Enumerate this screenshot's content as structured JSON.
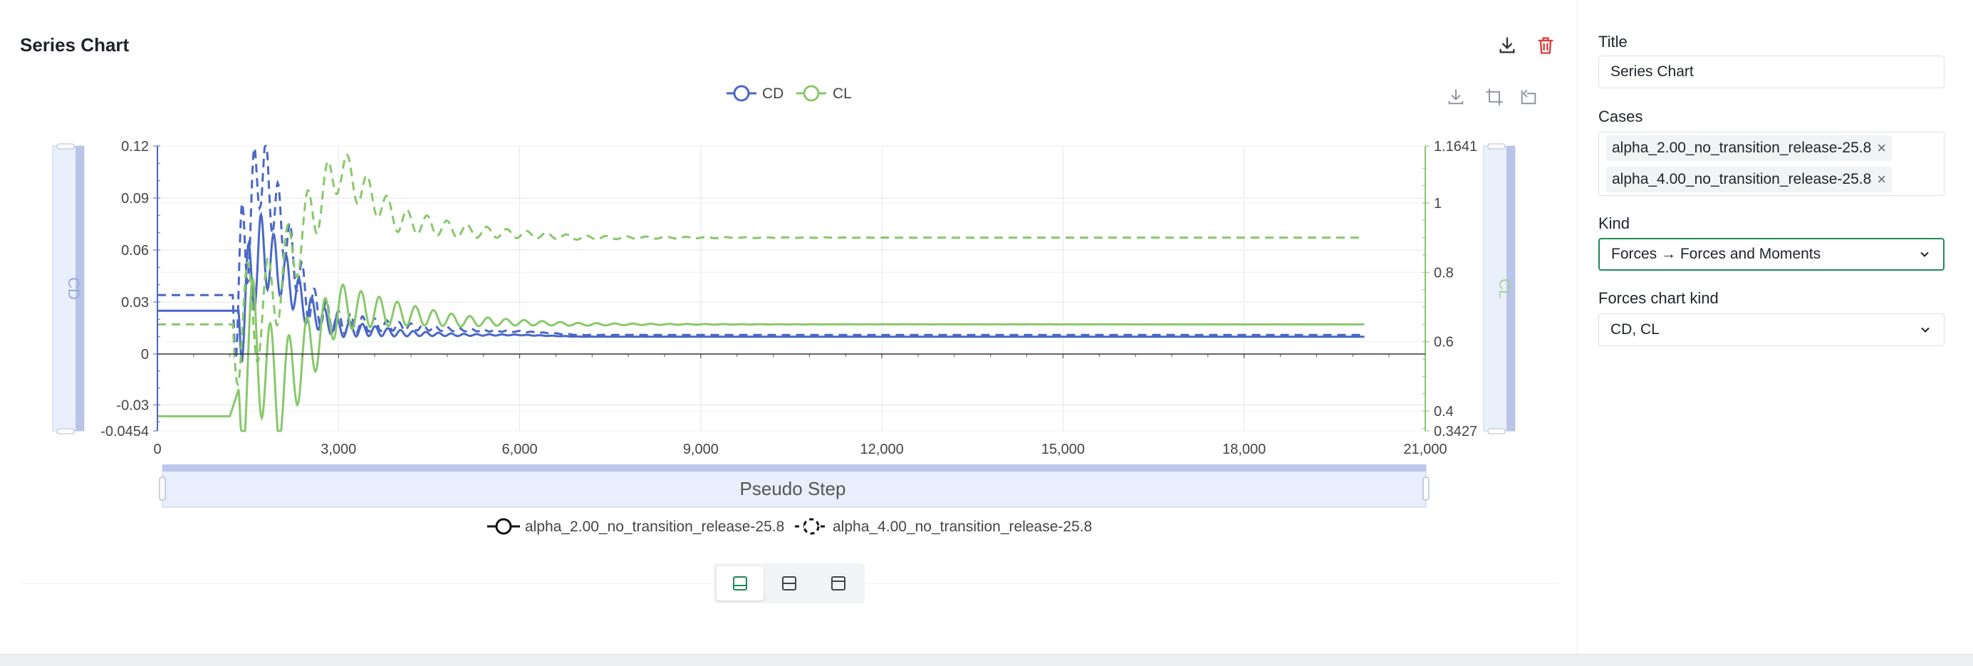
{
  "card": {
    "title": "Series Chart"
  },
  "header_actions": [
    {
      "icon": "download-icon"
    },
    {
      "icon": "trash-icon",
      "color": "#e23b3b"
    }
  ],
  "toolbox": [
    {
      "icon": "save-image-icon"
    },
    {
      "icon": "zoom-select-icon"
    },
    {
      "icon": "zoom-reset-icon"
    }
  ],
  "panel": {
    "title_label": "Title",
    "title_value": "Series Chart",
    "cases_label": "Cases",
    "cases": [
      "alpha_2.00_no_transition_release-25.8",
      "alpha_4.00_no_transition_release-25.8"
    ],
    "kind_label": "Kind",
    "kind_value": "Forces → Forces and Moments",
    "forces_label": "Forces chart kind",
    "forces_value": "CD, CL"
  },
  "layout_buttons": [
    {
      "icon": "layout-bottom-icon",
      "active": true
    },
    {
      "icon": "layout-split-icon",
      "active": false
    },
    {
      "icon": "layout-top-icon",
      "active": false
    }
  ],
  "colors": {
    "cd": "#4a67c6",
    "cl": "#88c86a",
    "accent": "#1e8a57",
    "danger": "#e23b3b"
  },
  "chart_data": {
    "type": "line",
    "title": "",
    "xlabel": "Pseudo Step",
    "ylabel_left": "CD",
    "ylabel_right": "CL",
    "xlim": [
      0,
      21000
    ],
    "ylim_left": [
      -0.0454,
      0.12
    ],
    "ylim_right": [
      0.3427,
      1.1641
    ],
    "x_ticks": [
      "0",
      "3,000",
      "6,000",
      "9,000",
      "12,000",
      "15,000",
      "18,000",
      "21,000"
    ],
    "y_ticks_left": [
      "0.12",
      "0.09",
      "0.06",
      "0.03",
      "0",
      "-0.03",
      "-0.0454"
    ],
    "y_ticks_right": [
      "1.1641",
      "1",
      "0.8",
      "0.6",
      "0.4",
      "0.3427"
    ],
    "grid": true,
    "legend_top": [
      "CD",
      "CL"
    ],
    "legend_bottom": [
      "alpha_2.00_no_transition_release-25.8",
      "alpha_4.00_no_transition_release-25.8"
    ],
    "series": [
      {
        "name": "CD",
        "case": "alpha_2.00_no_transition_release-25.8",
        "axis": "left",
        "style": "solid",
        "x": [
          0,
          1400,
          1700,
          2000,
          2500,
          3000,
          4000,
          5000,
          6000,
          7000,
          20000
        ],
        "y": [
          0.025,
          0.025,
          0.06,
          0.05,
          0.025,
          0.015,
          0.012,
          0.011,
          0.011,
          0.01,
          0.01
        ]
      },
      {
        "name": "CD",
        "case": "alpha_4.00_no_transition_release-25.8",
        "axis": "left",
        "style": "dashed",
        "x": [
          0,
          1300,
          1700,
          2000,
          2500,
          3000,
          4000,
          5000,
          6000,
          7000,
          20000
        ],
        "y": [
          0.034,
          0.034,
          0.11,
          0.08,
          0.03,
          0.018,
          0.016,
          0.014,
          0.013,
          0.011,
          0.011
        ]
      },
      {
        "name": "CL",
        "case": "alpha_2.00_no_transition_release-25.8",
        "axis": "right",
        "style": "solid",
        "x": [
          0,
          1200,
          1600,
          2000,
          3000,
          4000,
          5000,
          6000,
          7000,
          20000
        ],
        "y": [
          0.385,
          0.385,
          0.6,
          0.45,
          0.7,
          0.68,
          0.66,
          0.655,
          0.65,
          0.65
        ]
      },
      {
        "name": "CL",
        "case": "alpha_4.00_no_transition_release-25.8",
        "axis": "right",
        "style": "dashed",
        "x": [
          0,
          1300,
          1800,
          2500,
          3000,
          4000,
          5000,
          6000,
          7000,
          9000,
          20000
        ],
        "y": [
          0.65,
          0.65,
          0.7,
          0.95,
          1.1,
          0.95,
          0.92,
          0.91,
          0.9,
          0.9,
          0.9
        ]
      }
    ]
  }
}
